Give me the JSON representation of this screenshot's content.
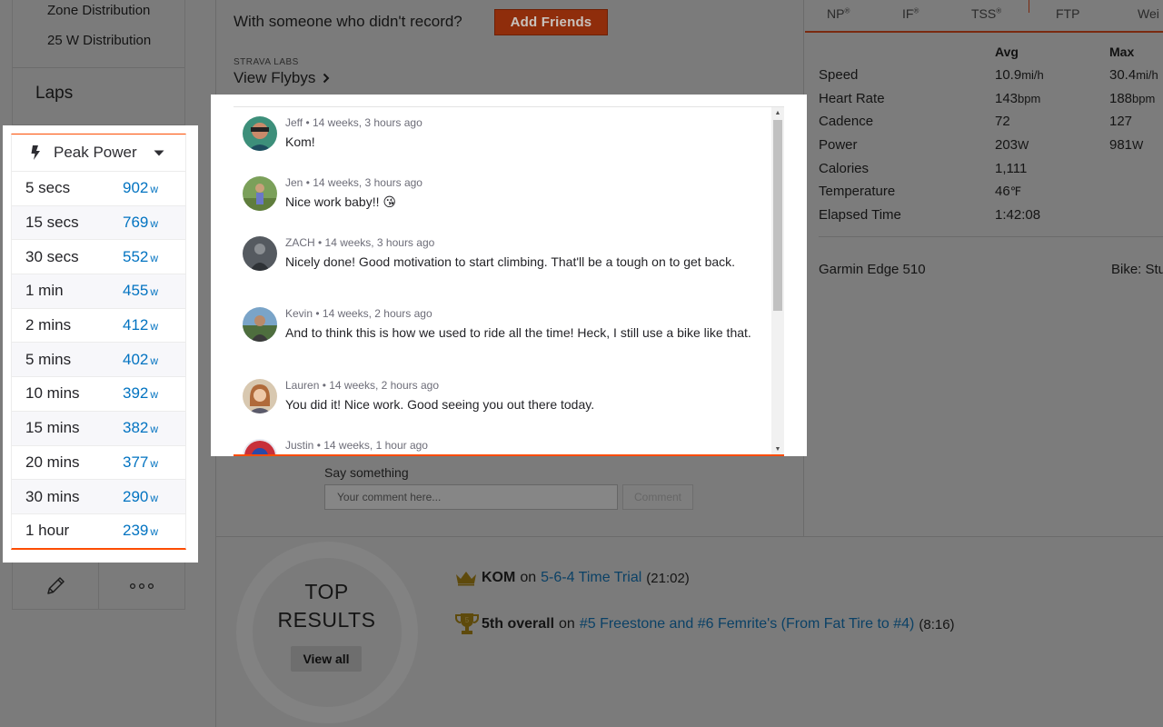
{
  "sidebar": {
    "nav_items": [
      "Zone Distribution",
      "25 W Distribution"
    ],
    "laps_label": "Laps"
  },
  "peak_power": {
    "title": "Peak Power",
    "unit": "w",
    "rows": [
      {
        "duration": "5 secs",
        "value": "902"
      },
      {
        "duration": "15 secs",
        "value": "769"
      },
      {
        "duration": "30 secs",
        "value": "552"
      },
      {
        "duration": "1 min",
        "value": "455"
      },
      {
        "duration": "2 mins",
        "value": "412"
      },
      {
        "duration": "5 mins",
        "value": "402"
      },
      {
        "duration": "10 mins",
        "value": "392"
      },
      {
        "duration": "15 mins",
        "value": "382"
      },
      {
        "duration": "20 mins",
        "value": "377"
      },
      {
        "duration": "30 mins",
        "value": "290"
      },
      {
        "duration": "1 hour",
        "value": "239"
      }
    ]
  },
  "actions": {
    "edit_icon": "pencil-icon",
    "more_icon": "more-dots-icon"
  },
  "header": {
    "record_prompt": "With someone who didn't record?",
    "add_friends": "Add Friends",
    "labs_label": "STRAVA LABS",
    "flybys_link": "View Flybys"
  },
  "comments": [
    {
      "author": "Jeff",
      "time": "14 weeks, 3 hours ago",
      "text": "Kom!"
    },
    {
      "author": "Jen",
      "time": "14 weeks, 3 hours ago",
      "text": "Nice work baby!! 😘"
    },
    {
      "author": "ZACH",
      "time": "14 weeks, 3 hours ago",
      "text": "Nicely done! Good motivation to start climbing. That'll be a tough on to get back."
    },
    {
      "author": "Kevin",
      "time": "14 weeks, 2 hours ago",
      "text": "And to think this is how we used to ride all the time! Heck, I still use a bike like that."
    },
    {
      "author": "Lauren",
      "time": "14 weeks, 2 hours ago",
      "text": "You did it! Nice work. Good seeing you out there today."
    },
    {
      "author": "Justin",
      "time": "14 weeks, 1 hour ago",
      "text": ""
    }
  ],
  "comment_form": {
    "label": "Say something",
    "placeholder": "Your comment here...",
    "submit": "Comment"
  },
  "metric_tabs": [
    "NP",
    "IF",
    "TSS",
    "FTP",
    "Wei"
  ],
  "stats": {
    "col_avg": "Avg",
    "col_max": "Max",
    "rows": [
      {
        "label": "Speed",
        "avg": "10.9",
        "avg_unit": "mi/h",
        "max": "30.4",
        "max_unit": "mi/h"
      },
      {
        "label": "Heart Rate",
        "avg": "143",
        "avg_unit": "bpm",
        "max": "188",
        "max_unit": "bpm"
      },
      {
        "label": "Cadence",
        "avg": "72",
        "avg_unit": "",
        "max": "127",
        "max_unit": ""
      },
      {
        "label": "Power",
        "avg": "203",
        "avg_unit": "W",
        "max": "981",
        "max_unit": "W"
      },
      {
        "label": "Calories",
        "avg": "1,111",
        "avg_unit": "",
        "max": "",
        "max_unit": ""
      },
      {
        "label": "Temperature",
        "avg": "46",
        "avg_unit": "℉",
        "max": "",
        "max_unit": ""
      },
      {
        "label": "Elapsed Time",
        "avg": "1:42:08",
        "avg_unit": "",
        "max": "",
        "max_unit": ""
      }
    ],
    "device": "Garmin Edge 510",
    "bike": "Bike: Stu"
  },
  "top_results": {
    "title_line1": "TOP",
    "title_line2": "RESULTS",
    "view_all": "View all",
    "items": [
      {
        "rank": "KOM",
        "on": "on",
        "segment": "5-6-4 Time Trial",
        "time": "(21:02)"
      },
      {
        "rank": "5th overall",
        "on": "on",
        "segment": "#5 Freestone and #6 Femrite's (From Fat Tire to #4)",
        "time": "(8:16)"
      }
    ]
  },
  "colors": {
    "accent": "#fc4c02",
    "link": "#0273c1"
  }
}
